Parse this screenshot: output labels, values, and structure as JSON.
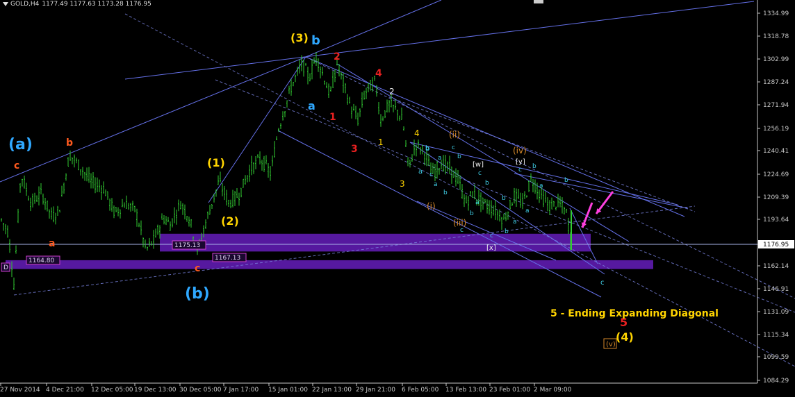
{
  "header": {
    "symbol": "GOLD,H4",
    "ohlc": "1177.49 1177.63 1173.28 1176.95"
  },
  "colors": {
    "background": "#000000",
    "candle": "#32cd32",
    "trendline": "#6470e8",
    "dashed": "#7a84e0",
    "zone": "#5b1aa8",
    "last_price_line": "#a8b4e8",
    "axis": "#c8c8c8",
    "yellow": "#ffd400",
    "red": "#e82020",
    "orange_red": "#ff5a1e",
    "blue": "#2fa8ff",
    "cyan": "#40d0e8",
    "orange": "#d88a2a",
    "white": "#f0f0f0",
    "magenta_arrow": "#ff40e0",
    "label_box": "#d040d0"
  },
  "chart_data": {
    "type": "candlestick",
    "title": "GOLD,H4",
    "y_ticks": [
      "1334.99",
      "1318.78",
      "1302.99",
      "1287.24",
      "1271.94",
      "1256.19",
      "1240.41",
      "1224.69",
      "1209.39",
      "1193.64",
      "1176.95",
      "1162.14",
      "1146.91",
      "1131.09",
      "1115.34",
      "1099.59",
      "1084.29"
    ],
    "x_ticks": [
      "27 Nov 2014",
      "4 Dec 21:00",
      "12 Dec 05:00",
      "19 Dec 13:00",
      "30 Dec 05:00",
      "7 Jan 17:00",
      "15 Jan 01:00",
      "22 Jan 13:00",
      "29 Jan 21:00",
      "6 Feb 05:00",
      "13 Feb 13:00",
      "23 Feb 01:00",
      "2 Mar 09:00"
    ],
    "ylim": [
      1084.29,
      1334.99
    ],
    "last_price": "1176.95",
    "price_path": [
      [
        0,
        1195
      ],
      [
        12,
        1185
      ],
      [
        20,
        1150
      ],
      [
        30,
        1225
      ],
      [
        45,
        1205
      ],
      [
        60,
        1212
      ],
      [
        75,
        1195
      ],
      [
        85,
        1200
      ],
      [
        100,
        1238
      ],
      [
        115,
        1230
      ],
      [
        130,
        1220
      ],
      [
        150,
        1215
      ],
      [
        165,
        1198
      ],
      [
        180,
        1205
      ],
      [
        195,
        1200
      ],
      [
        210,
        1173
      ],
      [
        222,
        1180
      ],
      [
        235,
        1195
      ],
      [
        245,
        1190
      ],
      [
        260,
        1205
      ],
      [
        272,
        1195
      ],
      [
        285,
        1172
      ],
      [
        295,
        1190
      ],
      [
        305,
        1205
      ],
      [
        315,
        1220
      ],
      [
        330,
        1205
      ],
      [
        345,
        1212
      ],
      [
        360,
        1228
      ],
      [
        375,
        1235
      ],
      [
        390,
        1225
      ],
      [
        400,
        1255
      ],
      [
        410,
        1270
      ],
      [
        420,
        1285
      ],
      [
        435,
        1300
      ],
      [
        445,
        1290
      ],
      [
        455,
        1305
      ],
      [
        465,
        1292
      ],
      [
        475,
        1278
      ],
      [
        485,
        1300
      ],
      [
        495,
        1285
      ],
      [
        505,
        1270
      ],
      [
        515,
        1262
      ],
      [
        525,
        1280
      ],
      [
        540,
        1288
      ],
      [
        548,
        1262
      ],
      [
        560,
        1272
      ],
      [
        572,
        1268
      ],
      [
        580,
        1260
      ],
      [
        588,
        1228
      ],
      [
        598,
        1245
      ],
      [
        610,
        1240
      ],
      [
        622,
        1225
      ],
      [
        635,
        1232
      ],
      [
        648,
        1228
      ],
      [
        660,
        1220
      ],
      [
        670,
        1205
      ],
      [
        680,
        1212
      ],
      [
        695,
        1205
      ],
      [
        712,
        1200
      ],
      [
        725,
        1193
      ],
      [
        740,
        1210
      ],
      [
        752,
        1205
      ],
      [
        765,
        1222
      ],
      [
        775,
        1213
      ],
      [
        790,
        1203
      ],
      [
        805,
        1205
      ],
      [
        815,
        1198
      ],
      [
        822,
        1178
      ]
    ],
    "zones": [
      {
        "label": "1175.13",
        "from": 1172,
        "to": 1184
      },
      {
        "label": "1167.13",
        "from": 1160,
        "to": 1166
      }
    ],
    "price_labels": [
      "1175.13",
      "1167.13",
      "1164.80",
      "D"
    ],
    "annotations": [
      {
        "text": "(a)",
        "color": "blue"
      },
      {
        "text": "c",
        "color": "orange_red"
      },
      {
        "text": "b",
        "color": "orange_red"
      },
      {
        "text": "a",
        "color": "orange_red"
      },
      {
        "text": "c",
        "color": "orange_red"
      },
      {
        "text": "(b)",
        "color": "blue"
      },
      {
        "text": "(1)",
        "color": "yellow"
      },
      {
        "text": "(2)",
        "color": "yellow"
      },
      {
        "text": "(3)",
        "color": "yellow"
      },
      {
        "text": "b",
        "color": "blue"
      },
      {
        "text": "a",
        "color": "blue"
      },
      {
        "text": "1",
        "color": "red"
      },
      {
        "text": "2",
        "color": "red"
      },
      {
        "text": "3",
        "color": "red"
      },
      {
        "text": "4",
        "color": "red"
      },
      {
        "text": "5",
        "color": "red"
      },
      {
        "text": "1",
        "color": "yellow"
      },
      {
        "text": "2",
        "color": "white"
      },
      {
        "text": "3",
        "color": "yellow"
      },
      {
        "text": "4",
        "color": "yellow"
      },
      {
        "text": "(i)",
        "color": "orange"
      },
      {
        "text": "(ii)",
        "color": "orange"
      },
      {
        "text": "(iii)",
        "color": "orange"
      },
      {
        "text": "(iv)",
        "color": "orange"
      },
      {
        "text": "(v)",
        "color": "orange"
      },
      {
        "text": "[w]",
        "color": "white"
      },
      {
        "text": "[y]",
        "color": "white"
      },
      {
        "text": "[x]",
        "color": "white"
      },
      {
        "text": "c",
        "color": "cyan"
      },
      {
        "text": "b",
        "color": "cyan"
      },
      {
        "text": "a",
        "color": "cyan"
      },
      {
        "text": "(4)",
        "color": "yellow"
      },
      {
        "text": "5 - Ending Expanding Diagonal",
        "color": "yellow"
      }
    ]
  }
}
